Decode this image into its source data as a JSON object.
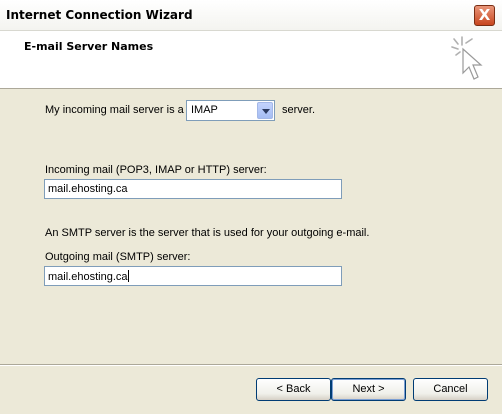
{
  "window": {
    "title": "Internet Connection Wizard",
    "close_symbol": "X"
  },
  "header": {
    "title": "E-mail Server Names",
    "icon": "wizard-sparkle-cursor-icon"
  },
  "form": {
    "incoming_prefix": "My incoming mail server is a",
    "server_type": {
      "selected": "IMAP"
    },
    "incoming_suffix": "server.",
    "incoming_label": "Incoming mail (POP3, IMAP or HTTP) server:",
    "incoming_value": "mail.ehosting.ca",
    "smtp_note": "An SMTP server is the server that is used for your outgoing e-mail.",
    "outgoing_label": "Outgoing mail (SMTP) server:",
    "outgoing_value": "mail.ehosting.ca"
  },
  "buttons": {
    "back": "< Back",
    "next": "Next >",
    "cancel": "Cancel"
  }
}
